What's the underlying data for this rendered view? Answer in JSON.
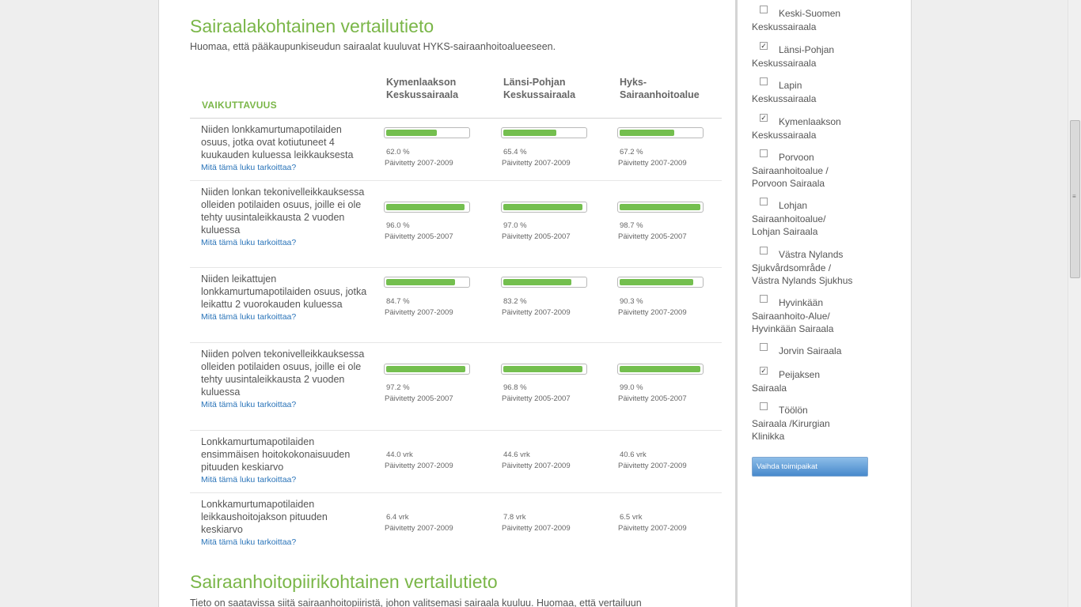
{
  "main": {
    "title": "Sairaalakohtainen vertailutieto",
    "note": "Huomaa, että pääkaupunkiseudun sairaalat kuuluvat HYKS-sairaanhoitoalueeseen.",
    "section_label": "VAIKUTTAVUUS",
    "columns": [
      "Kymenlaakson Keskussairaala",
      "Länsi-Pohjan Keskussairaala",
      "Hyks-Sairaanhoitoalue"
    ],
    "rows": [
      {
        "label": "Niiden lonkkamurtumapotilaiden osuus, jotka ovat kotiutuneet 4 kuukauden kuluessa leikkauksesta",
        "link": "Mitä tämä luku tarkoittaa?",
        "cells": [
          {
            "value": "62.0 %",
            "percent": 62.0,
            "date": "Päivitetty 2007-2009"
          },
          {
            "value": "65.4 %",
            "percent": 65.4,
            "date": "Päivitetty 2007-2009"
          },
          {
            "value": "67.2 %",
            "percent": 67.2,
            "date": "Päivitetty 2007-2009"
          }
        ]
      },
      {
        "label": "Niiden lonkan tekonivelleikkauksessa olleiden potilaiden osuus, joille ei ole tehty uusintaleikkausta 2 vuoden kuluessa",
        "link": "Mitä tämä luku tarkoittaa?",
        "cells": [
          {
            "value": "96.0 %",
            "percent": 96.0,
            "date": "Päivitetty 2005-2007"
          },
          {
            "value": "97.0 %",
            "percent": 97.0,
            "date": "Päivitetty 2005-2007"
          },
          {
            "value": "98.7 %",
            "percent": 98.7,
            "date": "Päivitetty 2005-2007"
          }
        ]
      },
      {
        "label": "Niiden leikattujen lonkkamurtumapotilaiden osuus, jotka leikattu 2 vuorokauden kuluessa",
        "link": "Mitä tämä luku tarkoittaa?",
        "cells": [
          {
            "value": "84.7 %",
            "percent": 84.7,
            "date": "Päivitetty 2007-2009"
          },
          {
            "value": "83.2 %",
            "percent": 83.2,
            "date": "Päivitetty 2007-2009"
          },
          {
            "value": "90.3 %",
            "percent": 90.3,
            "date": "Päivitetty 2007-2009"
          }
        ]
      },
      {
        "label": "Niiden polven tekonivelleikkauksessa olleiden potilaiden osuus, joille ei ole tehty uusintaleikkausta 2 vuoden kuluessa",
        "link": "Mitä tämä luku tarkoittaa?",
        "cells": [
          {
            "value": "97.2 %",
            "percent": 97.2,
            "date": "Päivitetty 2005-2007"
          },
          {
            "value": "96.8 %",
            "percent": 96.8,
            "date": "Päivitetty 2005-2007"
          },
          {
            "value": "99.0 %",
            "percent": 99.0,
            "date": "Päivitetty 2005-2007"
          }
        ]
      },
      {
        "label": "Lonkkamurtumapotilaiden ensimmäisen hoitokokonaisuuden pituuden keskiarvo",
        "link": "Mitä tämä luku tarkoittaa?",
        "cells": [
          {
            "value": "44.0 vrk",
            "date": "Päivitetty 2007-2009"
          },
          {
            "value": "44.6 vrk",
            "date": "Päivitetty 2007-2009"
          },
          {
            "value": "40.6 vrk",
            "date": "Päivitetty 2007-2009"
          }
        ]
      },
      {
        "label": "Lonkkamurtumapotilaiden leikkaushoitojakson pituuden keskiarvo",
        "link": "Mitä tämä luku tarkoittaa?",
        "cells": [
          {
            "value": "6.4 vrk",
            "date": "Päivitetty 2007-2009"
          },
          {
            "value": "7.8 vrk",
            "date": "Päivitetty 2007-2009"
          },
          {
            "value": "6.5 vrk",
            "date": "Päivitetty 2007-2009"
          }
        ]
      }
    ]
  },
  "sidebar": {
    "hospitals": [
      {
        "lines": [
          "Keski-Suomen",
          "Keskussairaala"
        ],
        "checked": false
      },
      {
        "lines": [
          "Länsi-Pohjan",
          "Keskussairaala"
        ],
        "checked": true
      },
      {
        "lines": [
          "Lapin",
          "Keskussairaala"
        ],
        "checked": false
      },
      {
        "lines": [
          "Kymenlaakson",
          "Keskussairaala"
        ],
        "checked": true
      },
      {
        "lines": [
          "Porvoon",
          "Sairaanhoitoalue /",
          "Porvoon Sairaala"
        ],
        "checked": false
      },
      {
        "lines": [
          "Lohjan",
          "Sairaanhoitoalue/",
          "Lohjan Sairaala"
        ],
        "checked": false
      },
      {
        "lines": [
          "Västra Nylands",
          "Sjukvårdsområde /",
          "Västra Nylands Sjukhus"
        ],
        "checked": false
      },
      {
        "lines": [
          "Hyvinkään",
          "Sairaanhoito-Alue/",
          "Hyvinkään Sairaala"
        ],
        "checked": false
      },
      {
        "lines": [
          "Jorvin Sairaala"
        ],
        "checked": false
      },
      {
        "lines": [
          "Peijaksen",
          "Sairaala"
        ],
        "checked": true
      },
      {
        "lines": [
          "Töölön",
          "Sairaala /Kirurgian",
          "Klinikka"
        ],
        "checked": false
      }
    ],
    "button_label": "Vaihda toimipaikat"
  },
  "section2": {
    "title": "Sairaanhoitopiirikohtainen vertailutieto",
    "note": "Tieto on saatavissa siitä sairaanhoitopiiristä, johon valitsemasi sairaala kuuluu. Huomaa, että vertailuun"
  },
  "colors": {
    "accent_green": "#7ab648",
    "bar_fill": "#74bf4f",
    "link_blue": "#2a74b9",
    "button_blue": "#4789cc"
  }
}
